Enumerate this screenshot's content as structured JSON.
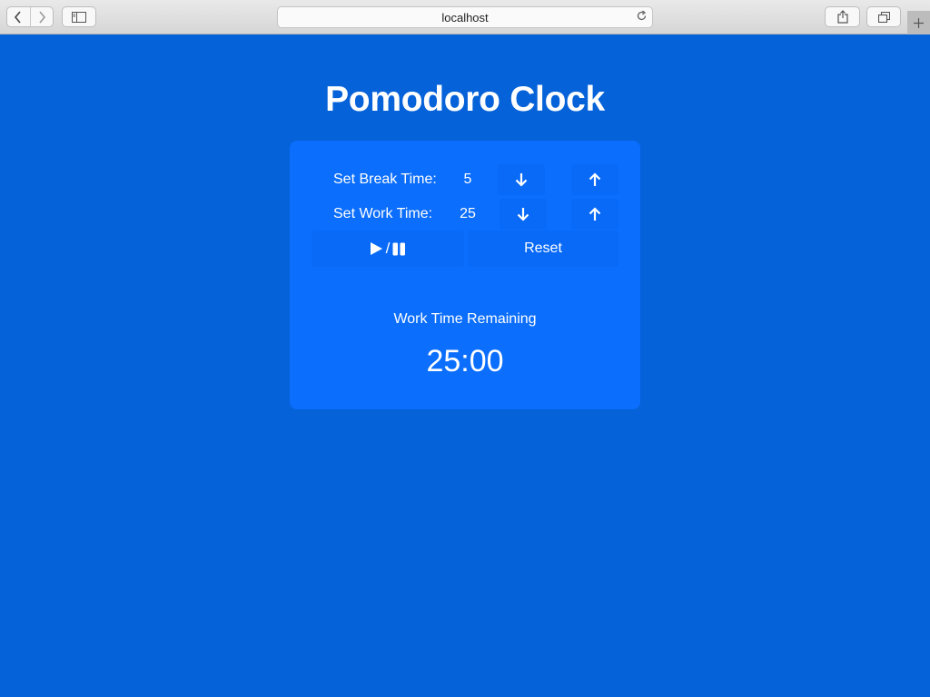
{
  "browser": {
    "url": "localhost",
    "icons": {
      "back": "chevron-left-icon",
      "forward": "chevron-right-icon",
      "sidebar": "sidebar-icon",
      "reload": "reload-icon",
      "share": "share-icon",
      "tabs": "tabs-overview-icon",
      "new_tab": "plus-icon"
    }
  },
  "app": {
    "title": "Pomodoro Clock",
    "break": {
      "label": "Set Break Time:",
      "value": "5"
    },
    "work": {
      "label": "Set Work Time:",
      "value": "25"
    },
    "controls": {
      "separator": "/",
      "reset_label": "Reset"
    },
    "status_label": "Work Time Remaining",
    "time_remaining": "25:00"
  },
  "colors": {
    "background": "#0562d9",
    "panel": "#0b6efd",
    "text": "#ffffff"
  }
}
